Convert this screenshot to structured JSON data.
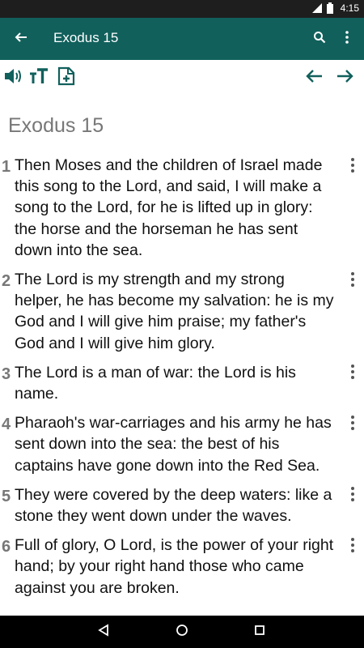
{
  "status_bar": {
    "time": "4:15",
    "network_label": "3G"
  },
  "app_bar": {
    "title": "Exodus 15",
    "back_icon": "arrow-left-icon",
    "search_icon": "search-icon",
    "menu_icon": "more-vert-icon"
  },
  "toolbar": {
    "icons": [
      "speaker-icon",
      "text-size-icon",
      "add-note-icon",
      "prev-chapter-icon",
      "next-chapter-icon"
    ]
  },
  "chapter": {
    "title": "Exodus 15"
  },
  "verses": [
    {
      "num": "1",
      "text": "Then Moses and the children of Israel made this song to the Lord, and said, I will make a song to the Lord, for he is lifted up in glory: the horse and the horseman he has sent down into the sea."
    },
    {
      "num": "2",
      "text": "The Lord is my strength and my strong helper, he has become my salvation: he is my God and I will give him praise; my father's God and I will give him glory."
    },
    {
      "num": "3",
      "text": "The Lord is a man of war: the Lord is his name."
    },
    {
      "num": "4",
      "text": "Pharaoh's war-carriages and his army he has sent down into the sea: the best of his captains have gone down into the Red Sea."
    },
    {
      "num": "5",
      "text": "They were covered by the deep waters: like a stone they went down under the waves."
    },
    {
      "num": "6",
      "text": "Full of glory, O Lord, is the power of your right hand; by your right hand those who came against you are broken."
    }
  ],
  "colors": {
    "app_bar": "#11605c",
    "status_bar": "#1e1e1e",
    "nav_bar": "#000000",
    "verse_number": "#777777",
    "toolbar_icon": "#11605c"
  }
}
